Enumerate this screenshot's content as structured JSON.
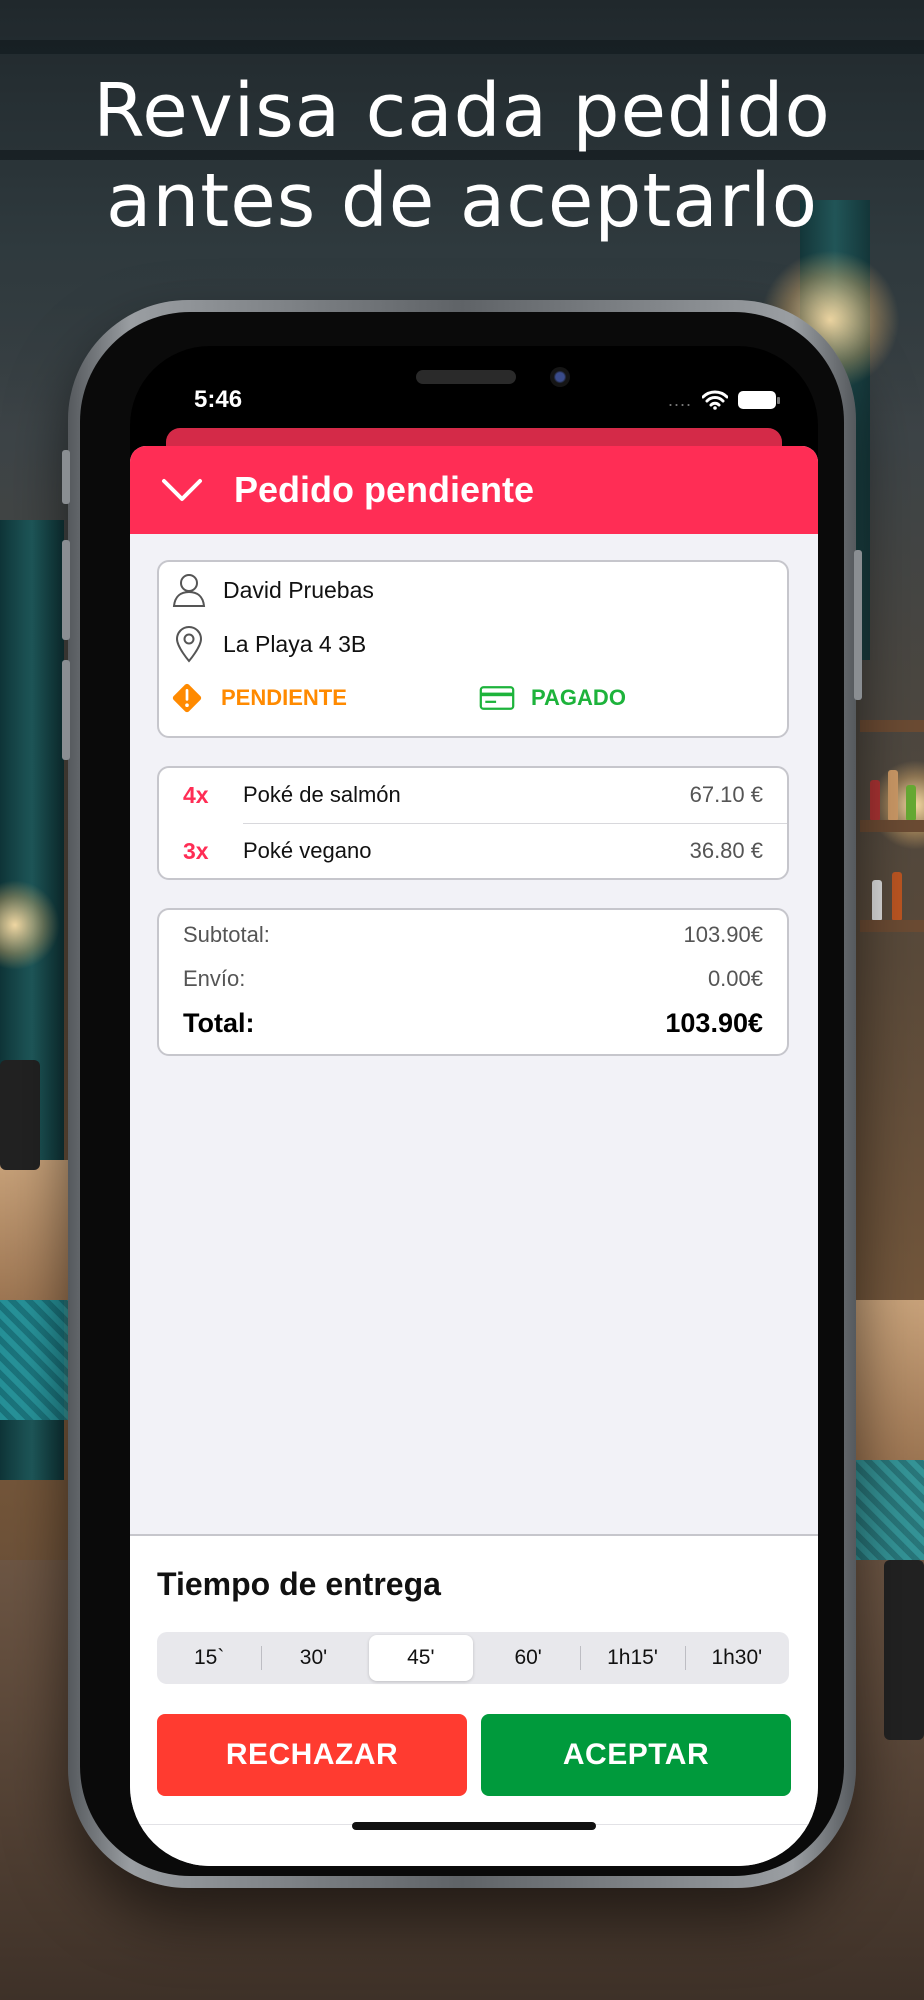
{
  "headline": {
    "line1": "Revisa cada pedido",
    "line2": "antes de aceptarlo"
  },
  "status_bar": {
    "time": "5:46",
    "signal": "....",
    "wifi_icon": "wifi-icon",
    "battery_icon": "battery-icon"
  },
  "sheet": {
    "title": "Pedido pendiente",
    "customer": {
      "name": "David Pruebas",
      "address": "La Playa 4 3B"
    },
    "status": {
      "order": "PENDIENTE",
      "payment": "PAGADO"
    },
    "items": [
      {
        "qty": "4x",
        "name": "Poké de salmón",
        "price": "67.10 €"
      },
      {
        "qty": "3x",
        "name": "Poké vegano",
        "price": "36.80 €"
      }
    ],
    "summary": {
      "subtotal_label": "Subtotal:",
      "subtotal_value": "103.90€",
      "shipping_label": "Envío:",
      "shipping_value": "0.00€",
      "total_label": "Total:",
      "total_value": "103.90€"
    }
  },
  "delivery": {
    "title": "Tiempo de entrega",
    "options": [
      "15`",
      "30'",
      "45'",
      "60'",
      "1h15'",
      "1h30'"
    ],
    "selected": "45'",
    "reject_label": "RECHAZAR",
    "accept_label": "ACEPTAR"
  },
  "colors": {
    "accent": "#ff2d55",
    "pending": "#ff8a00",
    "paid": "#1db33b",
    "reject": "#ff3b30",
    "accept": "#009a3c"
  }
}
